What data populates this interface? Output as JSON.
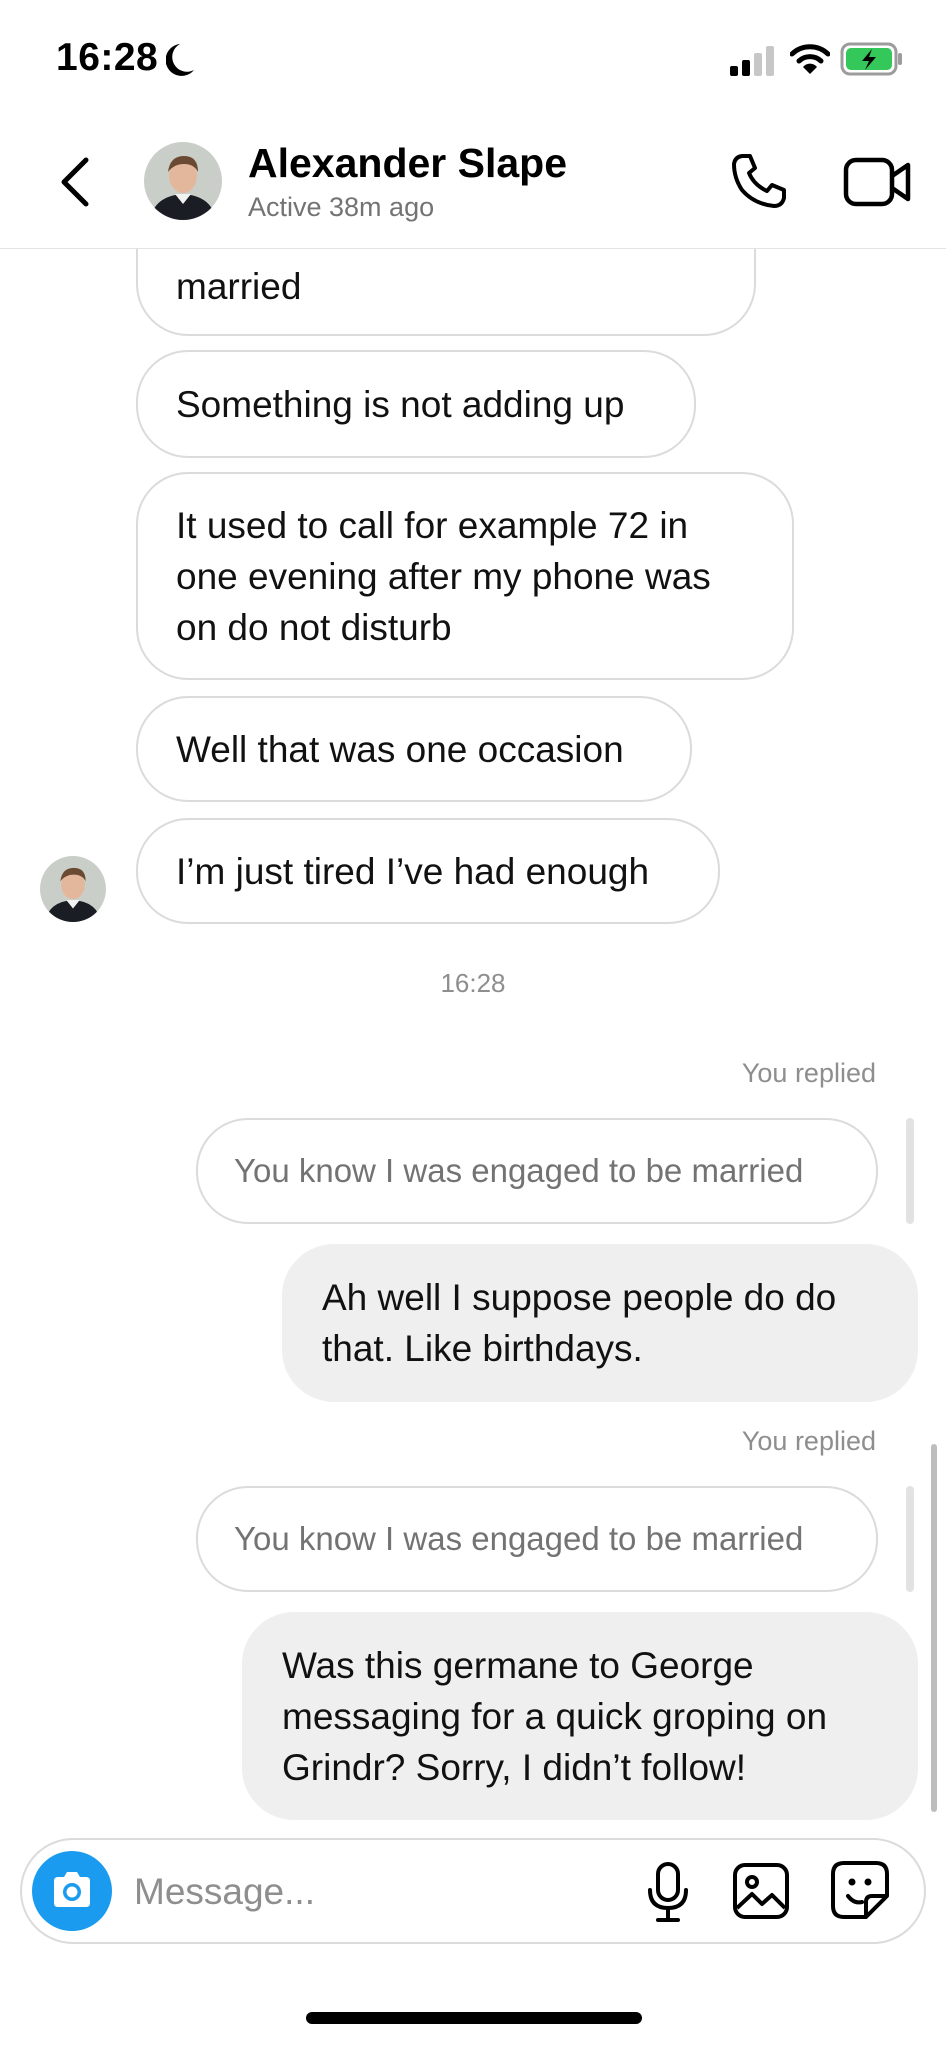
{
  "status_bar": {
    "time": "16:28"
  },
  "header": {
    "name": "Alexander Slape",
    "status": "Active 38m ago"
  },
  "messages_received": [
    {
      "text": "married"
    },
    {
      "text": "Something is not adding up"
    },
    {
      "text": "It used to call for example 72 in one evening after my phone was on do not disturb"
    },
    {
      "text": "Well that was one occasion"
    },
    {
      "text": "I’m just tired I’ve had enough"
    }
  ],
  "timestamp": "16:28",
  "replies": [
    {
      "label": "You replied",
      "quoted": "You know I was engaged to be married",
      "text": "Ah well I suppose people do do that. Like birthdays."
    },
    {
      "label": "You replied",
      "quoted": "You know I was engaged to be married",
      "text": "Was this germane to George messaging for a quick groping on Grindr? Sorry, I didn’t follow!"
    }
  ],
  "composer": {
    "placeholder": "Message..."
  },
  "colors": {
    "accent": "#1a9bf0",
    "battery": "#34c759",
    "outgoing_bubble": "#efefef"
  }
}
